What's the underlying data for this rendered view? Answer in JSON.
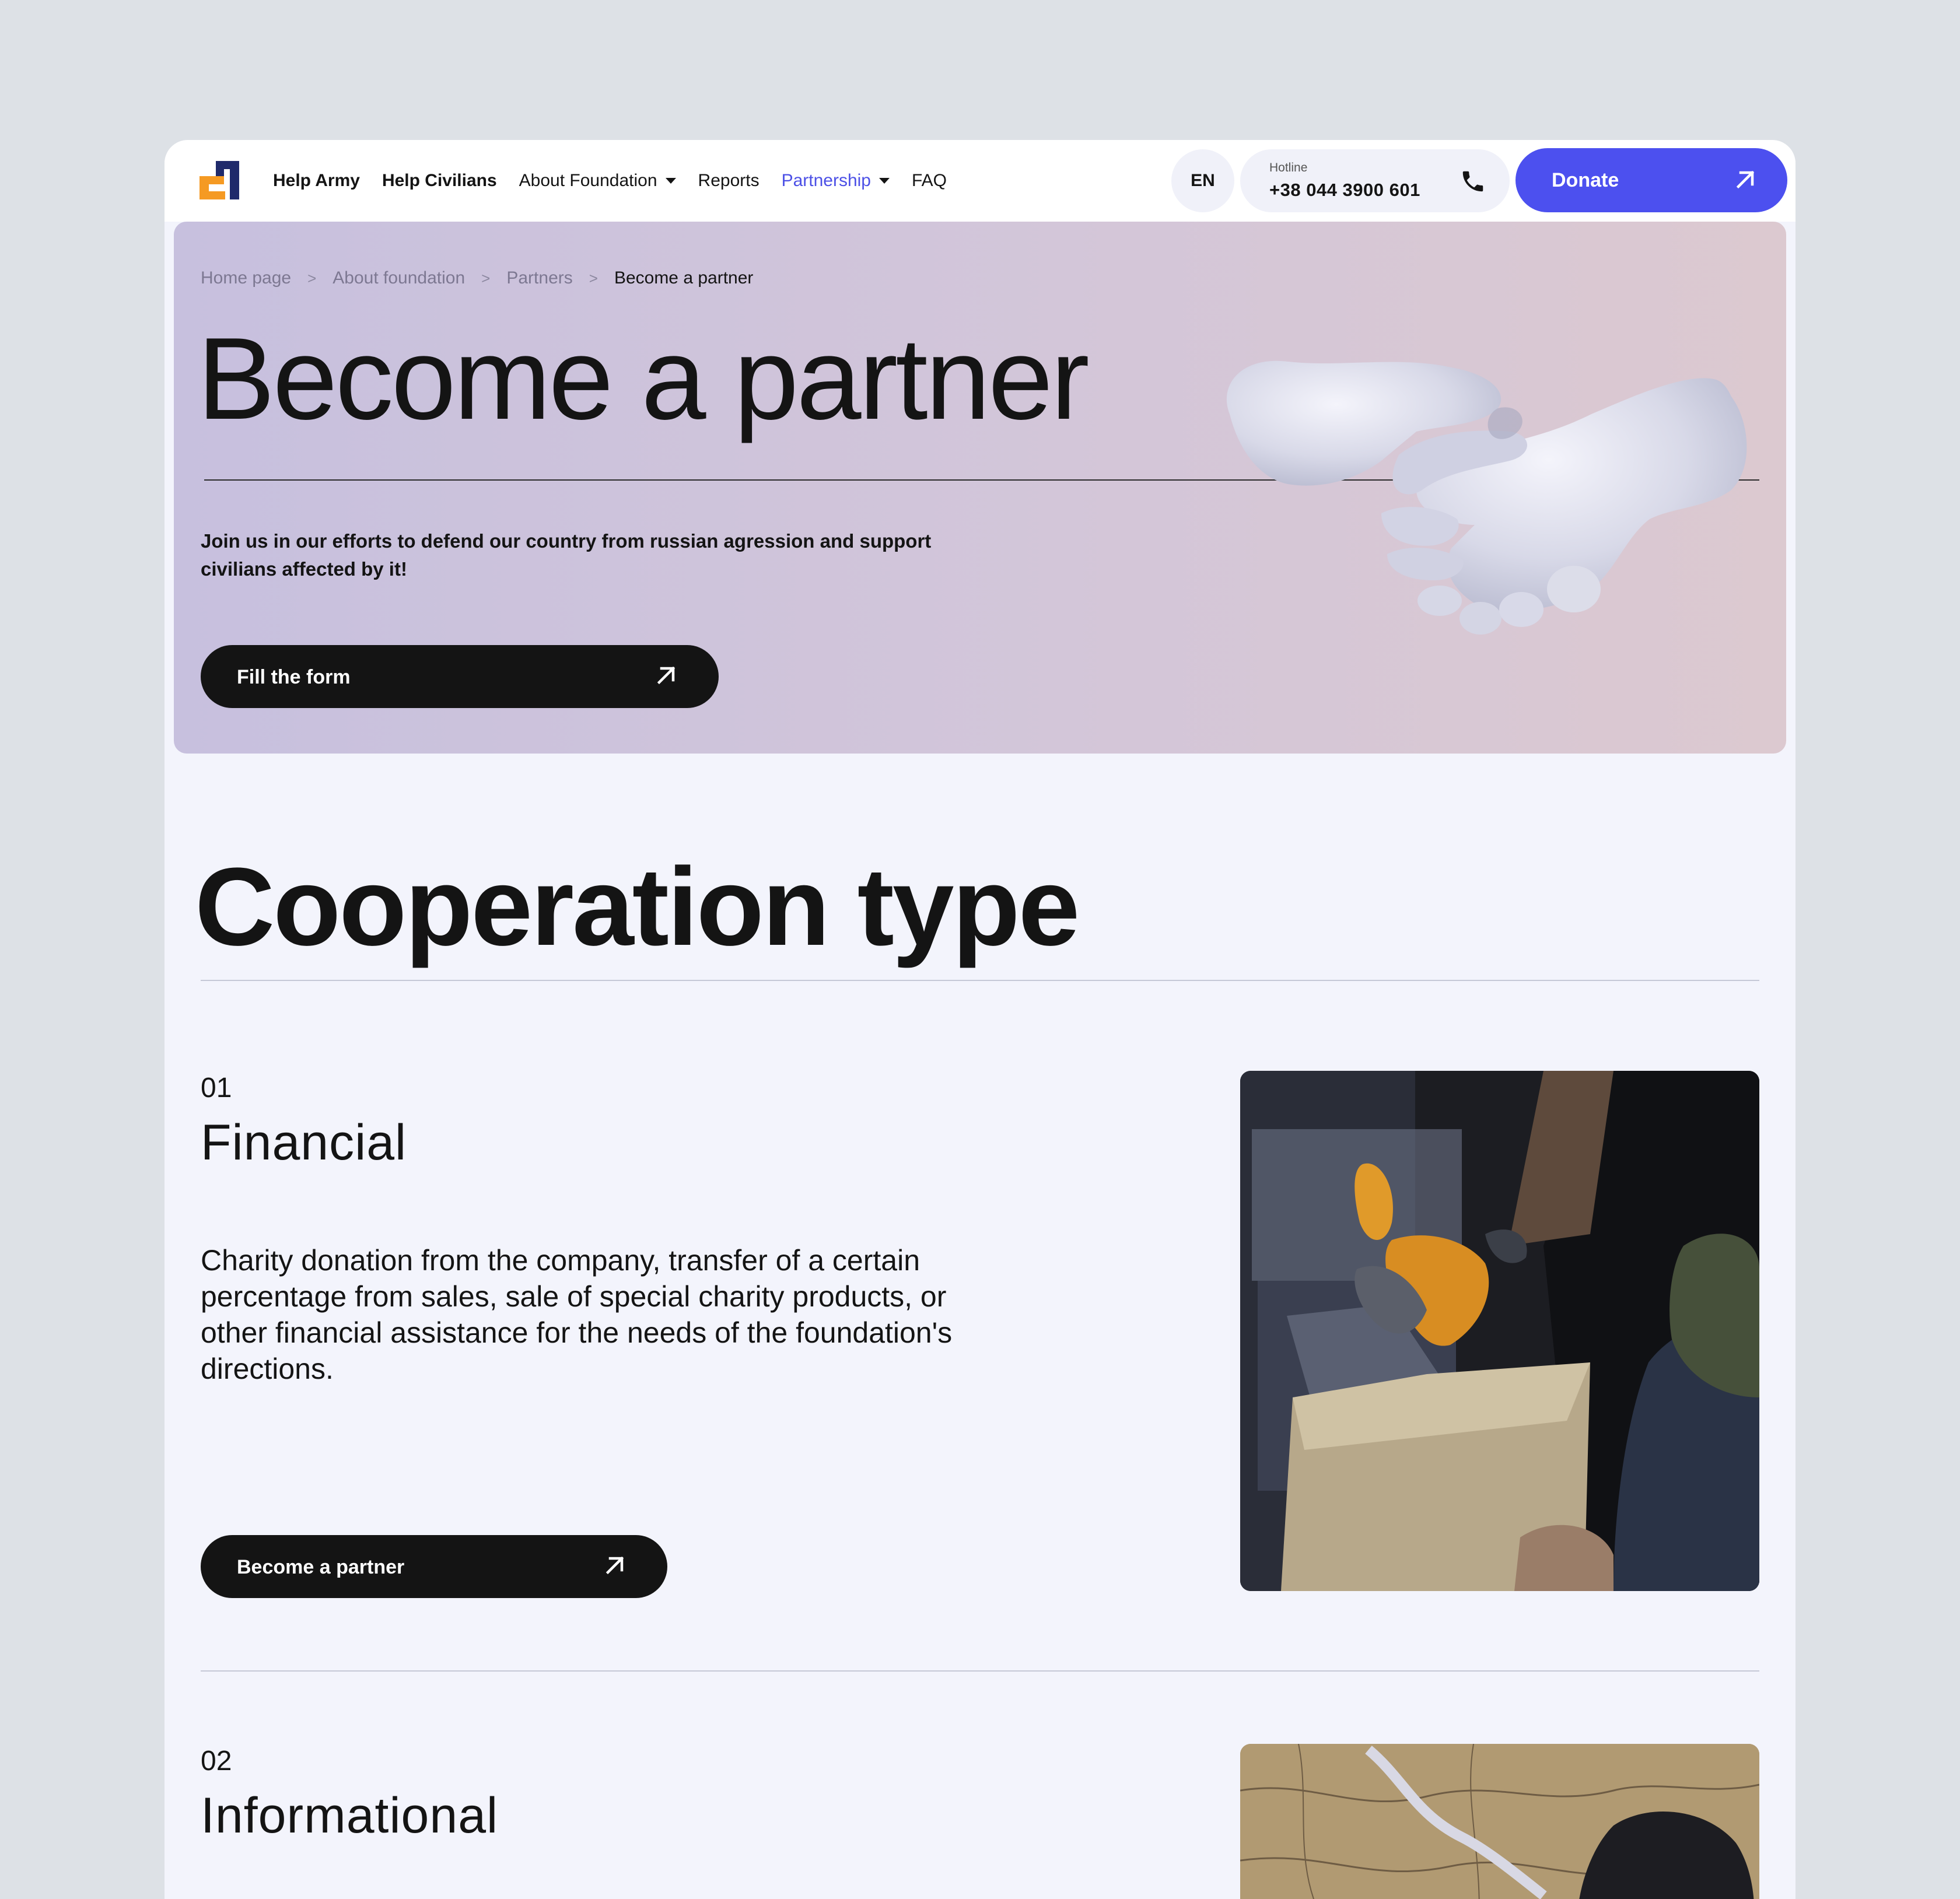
{
  "header": {
    "nav": [
      {
        "label": "Help Army",
        "bold": true
      },
      {
        "label": "Help Civilians",
        "bold": true
      },
      {
        "label": "About Foundation",
        "dropdown": true
      },
      {
        "label": "Reports"
      },
      {
        "label": "Partnership",
        "dropdown": true,
        "active": true
      },
      {
        "label": "FAQ"
      }
    ],
    "language": "EN",
    "hotline_label": "Hotline",
    "hotline_number": "+38 044 3900 601",
    "donate_label": "Donate"
  },
  "breadcrumb": [
    "Home page",
    "About foundation",
    "Partners",
    "Become a partner"
  ],
  "hero": {
    "title": "Become a partner",
    "subtitle": "Join us in our efforts to defend our country from russian agression and support civilians affected by it!",
    "button_label": "Fill the form"
  },
  "cooperation": {
    "title": "Cooperation type",
    "items": [
      {
        "number": "01",
        "heading": "Financial",
        "description": "Charity donation from the company, transfer of a certain percentage from sales, sale of special charity products, or other financial assistance for the needs of the foundation's directions.",
        "button_label": "Become a partner"
      },
      {
        "number": "02",
        "heading": "Informational"
      }
    ]
  },
  "colors": {
    "accent": "#4c50ef",
    "active_nav": "#4c50e6",
    "dark_button": "#141414",
    "page_bg": "#f3f4fc",
    "outer_bg": "#dde1e6",
    "logo_orange": "#f59a23",
    "logo_navy": "#1f2a6b"
  },
  "icons": {
    "phone": "phone-icon",
    "arrow": "arrow-up-right-icon",
    "caret": "caret-down-icon"
  }
}
